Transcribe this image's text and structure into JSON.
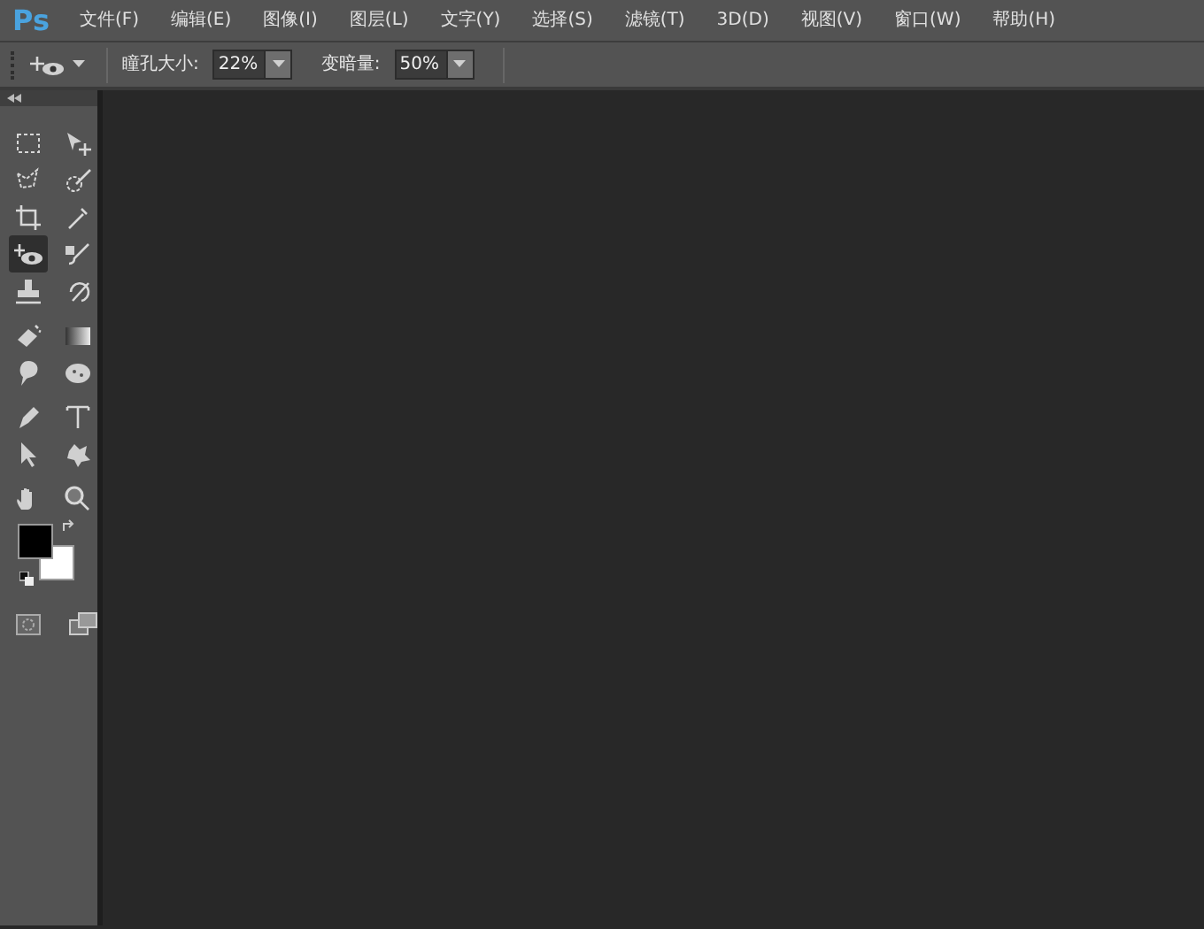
{
  "app_logo": "Ps",
  "menu": [
    {
      "label": "文件(F)"
    },
    {
      "label": "编辑(E)"
    },
    {
      "label": "图像(I)"
    },
    {
      "label": "图层(L)"
    },
    {
      "label": "文字(Y)"
    },
    {
      "label": "选择(S)"
    },
    {
      "label": "滤镜(T)"
    },
    {
      "label": "3D(D)"
    },
    {
      "label": "视图(V)"
    },
    {
      "label": "窗口(W)"
    },
    {
      "label": "帮助(H)"
    }
  ],
  "options": [
    {
      "label": "瞳孔大小:",
      "value": "22%"
    },
    {
      "label": "变暗量:",
      "value": "50%"
    }
  ],
  "tools": [
    {
      "selected": false
    },
    {
      "selected": false
    },
    {
      "selected": false
    },
    {
      "selected": false
    },
    {
      "selected": false
    },
    {
      "selected": false
    },
    {
      "selected": true
    },
    {
      "selected": false
    },
    {
      "selected": false
    },
    {
      "selected": false
    },
    {
      "selected": false
    },
    {
      "selected": false
    },
    {
      "selected": false
    },
    {
      "selected": false
    },
    {
      "selected": false
    },
    {
      "selected": false
    },
    {
      "selected": false
    },
    {
      "selected": false
    },
    {
      "selected": false
    },
    {
      "selected": false
    }
  ],
  "swatches": [
    {
      "color": "#000000"
    },
    {
      "color": "#ffffff"
    }
  ]
}
